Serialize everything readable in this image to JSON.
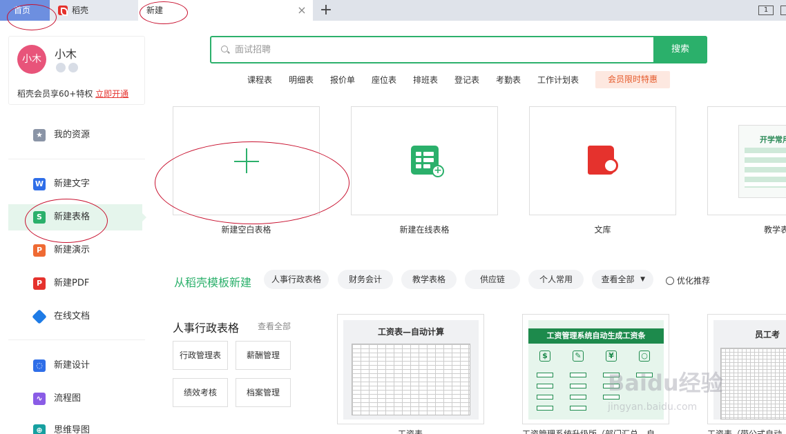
{
  "tabs": {
    "home": "首页",
    "daoke": "稻壳",
    "new": "新建"
  },
  "user": {
    "avatar_text": "小木",
    "name": "小木",
    "member_text": "稻壳会员享60+特权",
    "member_link": "立即开通"
  },
  "sidebar": {
    "items": [
      {
        "label": "我的资源"
      },
      {
        "label": "新建文字"
      },
      {
        "label": "新建表格"
      },
      {
        "label": "新建演示"
      },
      {
        "label": "新建PDF"
      },
      {
        "label": "在线文档"
      },
      {
        "label": "新建设计"
      },
      {
        "label": "流程图"
      },
      {
        "label": "思维导图"
      }
    ]
  },
  "search": {
    "placeholder": "面试招聘",
    "button": "搜索",
    "keywords": [
      "课程表",
      "明细表",
      "报价单",
      "座位表",
      "排班表",
      "登记表",
      "考勤表",
      "工作计划表"
    ],
    "vip": "会员限时特惠"
  },
  "cards": [
    {
      "label": "新建空白表格"
    },
    {
      "label": "新建在线表格"
    },
    {
      "label": "文库"
    },
    {
      "label": "教学表",
      "preview_title": "开学常用"
    }
  ],
  "templates": {
    "title": "从稻壳模板新建",
    "chips": [
      "人事行政表格",
      "财务会计",
      "教学表格",
      "供应链",
      "个人常用",
      "查看全部"
    ],
    "optimize": "优化推荐"
  },
  "category": {
    "title": "人事行政表格",
    "more": "查看全部",
    "tags": [
      "行政管理表",
      "薪酬管理",
      "绩效考核",
      "档案管理"
    ]
  },
  "thumbs": [
    {
      "preview_title": "工资表—自动计算",
      "name": "工资表"
    },
    {
      "preview_title": "工资管理系统自动生成工资条",
      "name": "工资管理系统升级版（部门汇总、自"
    },
    {
      "preview_title": "员工考",
      "name": "工资表（带公式自动"
    }
  ],
  "watermark": {
    "brand": "Baidu经验",
    "url": "jingyan.baidu.com"
  },
  "colors": {
    "accent": "#2bb06b",
    "annotation": "#c8102e",
    "home_tab": "#6d8fe0"
  }
}
